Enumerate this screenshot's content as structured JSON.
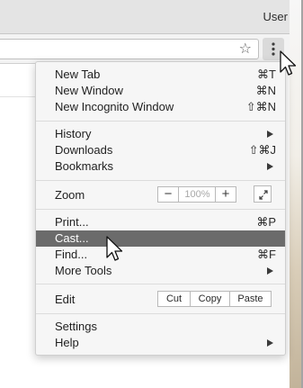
{
  "window": {
    "user_label": "User"
  },
  "menu": {
    "items": [
      {
        "label": "New Tab",
        "shortcut": "⌘T"
      },
      {
        "label": "New Window",
        "shortcut": "⌘N"
      },
      {
        "label": "New Incognito Window",
        "shortcut": "⇧⌘N"
      },
      {
        "label": "History",
        "submenu": true
      },
      {
        "label": "Downloads",
        "shortcut": "⇧⌘J"
      },
      {
        "label": "Bookmarks",
        "submenu": true
      },
      {
        "label": "Zoom"
      },
      {
        "label": "Print...",
        "shortcut": "⌘P"
      },
      {
        "label": "Cast...",
        "highlighted": true
      },
      {
        "label": "Find...",
        "shortcut": "⌘F"
      },
      {
        "label": "More Tools",
        "submenu": true
      },
      {
        "label": "Edit"
      },
      {
        "label": "Settings"
      },
      {
        "label": "Help",
        "submenu": true
      }
    ],
    "zoom": {
      "minus": "−",
      "value": "100%",
      "plus": "+"
    },
    "edit": {
      "cut": "Cut",
      "copy": "Copy",
      "paste": "Paste"
    }
  },
  "icons": {
    "star": "star-icon",
    "menu": "three-dots-vertical-icon",
    "fullscreen": "fullscreen-icon",
    "cursor": "mouse-pointer-icon"
  },
  "colors": {
    "highlight": "#6b6b6b",
    "menu_background": "#f6f6f6",
    "titlebar": "#e4e4e4"
  }
}
